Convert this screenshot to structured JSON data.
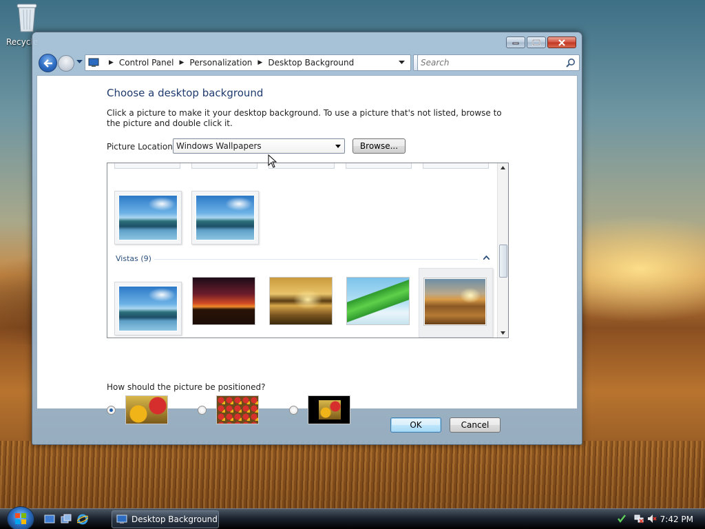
{
  "desktop": {
    "recycle_bin_label": "Recycle"
  },
  "window": {
    "address": {
      "crumbs": [
        "Control Panel",
        "Personalization",
        "Desktop Background"
      ]
    },
    "search": {
      "placeholder": "Search"
    },
    "heading": "Choose a desktop background",
    "description": "Click a picture to make it your desktop background. To use a picture that's not listed, browse to the picture and double click it.",
    "picture_location_label": "Picture Location",
    "picture_location_value": "Windows Wallpapers",
    "browse_label": "Browse...",
    "gallery": {
      "group_label": "Vistas (9)"
    },
    "position_question": "How should the picture be positioned?",
    "ok_label": "OK",
    "cancel_label": "Cancel"
  },
  "taskbar": {
    "task_label": "Desktop Background",
    "time": "7:42 PM"
  },
  "colors": {
    "heading": "#1e3a6e",
    "group_label": "#2b4f7c",
    "default_button_border": "#3c7fb1"
  }
}
